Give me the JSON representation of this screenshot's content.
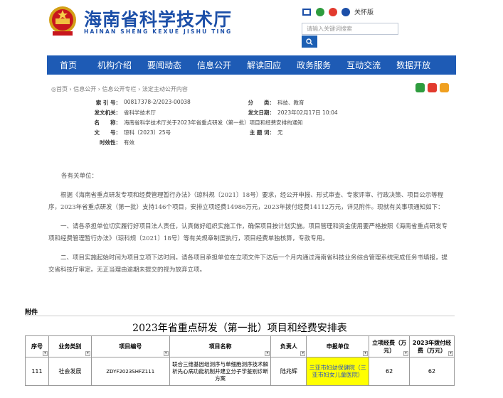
{
  "header": {
    "title_cn": "海南省科学技术厅",
    "title_en": "HAINAN SHENG KEXUE JISHU TING",
    "access_label": "关怀版",
    "search_placeholder": "请输入关键词搜索"
  },
  "nav": [
    "首页",
    "机构介绍",
    "要闻动态",
    "信息公开",
    "解读回应",
    "政务服务",
    "互动交流",
    "数据开放"
  ],
  "breadcrumb": "◎首页 › 信息公开 › 信息公开专栏 › 法定主动公开内容",
  "meta": {
    "index_k": "索 引 号：",
    "index_v": "00817378-2/2023-00038",
    "category_k": "分　　类：",
    "category_v": "科技、教育",
    "issuer_k": "发文机关：",
    "issuer_v": "省科学技术厅",
    "date_k": "发文日期：",
    "date_v": "2023年02月17日 10:04",
    "name_k": "名　　称：",
    "name_v": "海南省科学技术厅关于2023年省重点研发（第一批）项目和经费安排的通知",
    "docno_k": "文　　号：",
    "docno_v": "琼科〔2023〕25号",
    "topic_k": "主 题 词：",
    "topic_v": "无",
    "validity_k": "时效性：",
    "validity_v": "有效"
  },
  "body": {
    "greeting": "各有关单位：",
    "p1": "根据《海南省重点研发专项和经费管理暂行办法》（琼科规〔2021〕18号）要求，经公开申报、形式审查、专家评审、行政决策、项目公示等程序，2023年省重点研发（第一批）支持146个项目，安排立项经费14986万元，2023年拨付经费14112万元，详见附件。现就有关事项通知如下：",
    "p2": "一、请各承担单位切实履行好项目法人责任，认真做好组织实施工作，确保项目按计划实施。项目管理和资金使用要严格按照《海南省重点研发专项和经费管理暂行办法》（琼科规〔2021〕18号）等有关规章制度执行，项目经费单独核算，专款专用。",
    "p3": "二、项目实施起始时间为项目立项下达时间。请各项目承担单位在立项文件下达后一个月内通过海南省科技业务综合管理系统完成任务书填报，提交省科技厅审定。无正当理由逾期未提交的视为放弃立项。"
  },
  "attachment": {
    "label": "附件",
    "table_title": "2023年省重点研发（第一批）项目和经费安排表",
    "headers": [
      "序号",
      "业务类别",
      "项目编号",
      "项目名称",
      "负责人",
      "申报单位",
      "立项经费（万元）",
      "2023年拨付经费（万元）"
    ],
    "row": {
      "no": "111",
      "type": "社会发展",
      "code": "ZDYF2023SHFZ111",
      "name": "联合三维基因组测序与单细胞测序技术解析先心病功能机制并建立分子学鉴别诊断方案",
      "leader": "陆兆辉",
      "unit": "三亚市妇幼保健院（三亚市妇女儿童医院）",
      "funding": "62",
      "funding_2023": "62"
    }
  },
  "colors": {
    "brand": "#1c4fa8",
    "nav_bg": "#1e5bb5",
    "highlight": "#ffff00"
  }
}
